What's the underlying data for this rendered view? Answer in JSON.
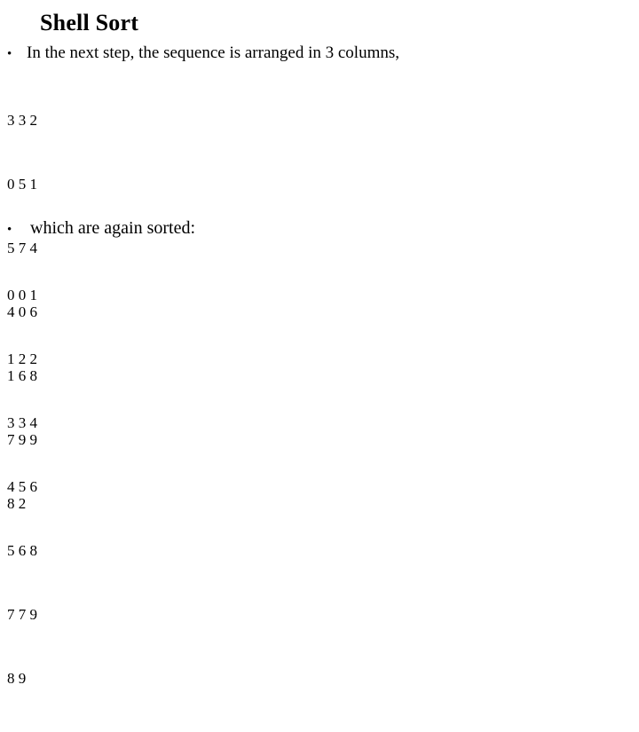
{
  "slide": {
    "title": "Shell Sort",
    "background_color": "#ffffff",
    "text_color": "#000000"
  },
  "bullets": [
    {
      "marker": "•",
      "text": "In the next step, the sequence is arranged in 3 columns,"
    },
    {
      "marker": "•",
      "text": "which are again sorted:"
    }
  ],
  "columns_block_1": {
    "rows": [
      "3 3 2",
      "0 5 1",
      "5 7 4",
      "4 0 6",
      "1 6 8",
      "7 9 9",
      "8 2"
    ]
  },
  "columns_block_2": {
    "rows": [
      "0 0 1",
      "1 2 2",
      "3 3 4",
      "4 5 6",
      "5 6 8",
      "7 7 9",
      "8 9"
    ]
  }
}
